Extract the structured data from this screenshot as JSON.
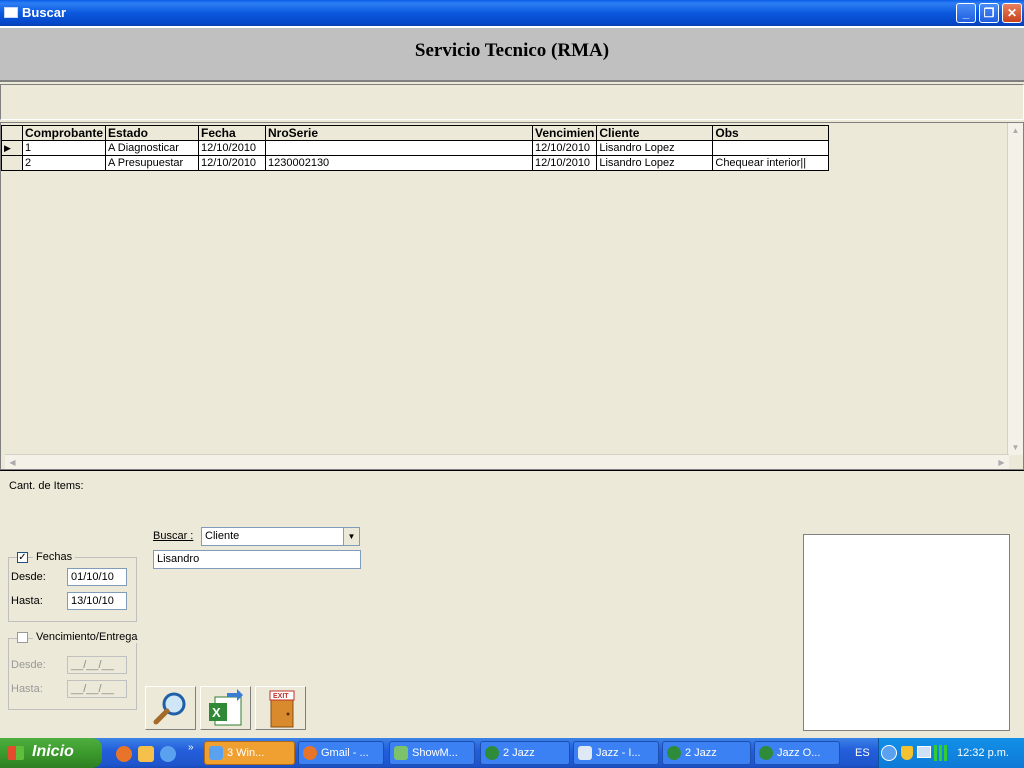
{
  "window": {
    "title": "Buscar"
  },
  "header": {
    "title": "Servicio Tecnico (RMA)"
  },
  "grid": {
    "columns": [
      "Comprobante",
      "Estado",
      "Fecha",
      "NroSerie",
      "Vencimien",
      "Cliente",
      "Obs"
    ],
    "rows": [
      [
        "1",
        "A Diagnosticar",
        "12/10/2010",
        "",
        "12/10/2010",
        "Lisandro Lopez",
        ""
      ],
      [
        "2",
        "A Presupuestar",
        "12/10/2010",
        "1230002130",
        "12/10/2010",
        "Lisandro Lopez",
        "Chequear interior||"
      ]
    ]
  },
  "footer": {
    "items_label": "Cant. de Items:"
  },
  "search": {
    "label": "Buscar :",
    "field_value": "Cliente",
    "text_value": "Lisandro"
  },
  "fechas": {
    "label": "Fechas",
    "checked": true,
    "desde_label": "Desde:",
    "desde_value": "01/10/10",
    "hasta_label": "Hasta:",
    "hasta_value": "13/10/10"
  },
  "vencimiento": {
    "label": "Vencimiento/Entrega",
    "checked": false,
    "desde_label": "Desde:",
    "desde_value": "__/__/__",
    "hasta_label": "Hasta:",
    "hasta_value": "__/__/__"
  },
  "buttons": {
    "exit_badge": "EXIT"
  },
  "taskbar": {
    "start_label": "Inicio",
    "items": [
      "3 Win...",
      "Gmail - ...",
      "ShowM...",
      "2 Jazz",
      "Jazz - I...",
      "2 Jazz",
      "Jazz O..."
    ],
    "language": "ES",
    "clock": "12:32 p.m."
  }
}
